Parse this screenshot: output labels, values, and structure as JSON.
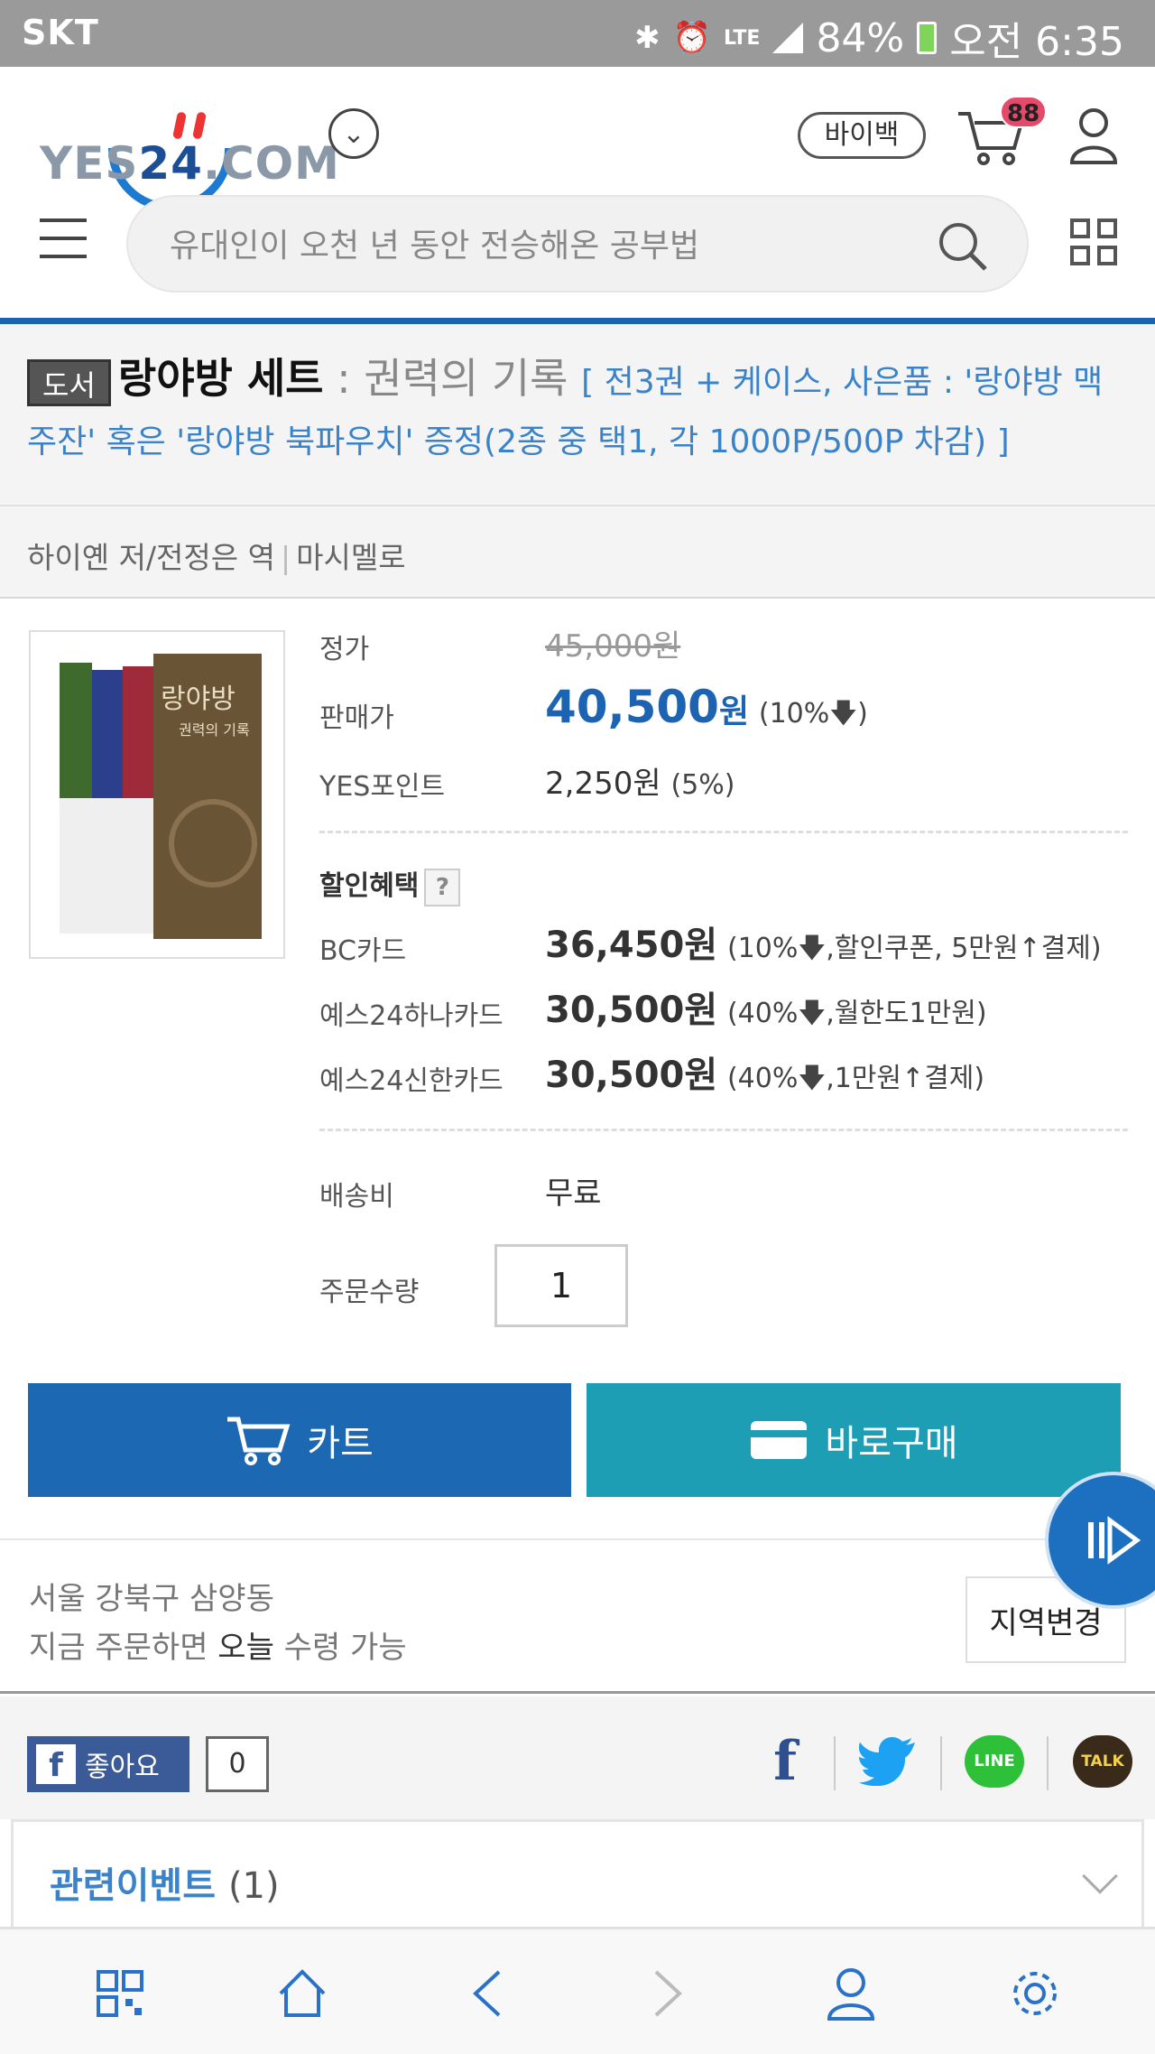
{
  "status_bar": {
    "carrier": "SKT",
    "network": "LTE",
    "battery": "84%",
    "time": "오전 6:35",
    "icons": [
      "bluetooth-icon",
      "alarm-icon",
      "lte-icon",
      "signal-icon",
      "battery-icon"
    ]
  },
  "header": {
    "logo_text_left": "YES",
    "logo_text_24": "24",
    "logo_text_right": ".COM",
    "payback_label": "바이백",
    "cart_count": "88",
    "search_placeholder": "유대인이 오천 년 동안 전승해온 공부법"
  },
  "product": {
    "category_badge": "도서",
    "title": "랑야방 세트",
    "subtitle": " : 권력의 기록 ",
    "bracket_info": "[ 전3권 + 케이스, 사은품 : '랑야방 맥주잔' 혹은 '랑야방 북파우치' 증정(2종 중 택1, 각 1000P/500P 차감) ]",
    "author": "하이옌 저/전정은 역",
    "publisher": "마시멜로",
    "cover_titles": [
      "랑야방",
      "권력의 기록"
    ]
  },
  "pricing": {
    "list_price_label": "정가",
    "list_price": "45,000원",
    "sale_price_label": "판매가",
    "sale_price": "40,500",
    "sale_price_unit": "원",
    "sale_discount": "(10%🡇)",
    "points_label": "YES포인트",
    "points": "2,250원",
    "points_rate": "(5%)",
    "discount_benefit_label": "할인혜택",
    "help_label": "?",
    "cards": [
      {
        "name": "BC카드",
        "price": "36,450원",
        "note": "(10%🡇,할인쿠폰, 5만원↑결제)"
      },
      {
        "name": "예스24하나카드",
        "price": "30,500원",
        "note": "(40%🡇,월한도1만원)"
      },
      {
        "name": "예스24신한카드",
        "price": "30,500원",
        "note": "(40%🡇,1만원↑결제)"
      }
    ],
    "shipping_label": "배송비",
    "shipping_value": "무료",
    "quantity_label": "주문수량",
    "quantity_value": "1"
  },
  "actions": {
    "cart_label": "카트",
    "buy_now_label": "바로구매"
  },
  "delivery": {
    "address": "서울 강북구 삼양동",
    "availability_prefix": "지금 주문하면 ",
    "availability_highlight": "오늘",
    "availability_suffix": " 수령 가능",
    "change_region_label": "지역변경"
  },
  "social": {
    "like_label": "좋아요",
    "like_count": "0",
    "line_label": "LINE",
    "talk_label": "TALK",
    "share_targets": [
      "facebook-icon",
      "twitter-icon",
      "line-icon",
      "kakaotalk-icon"
    ]
  },
  "events": {
    "title": "관련이벤트",
    "count": "(1)"
  },
  "bottom_nav": [
    "qr-code-icon",
    "home-icon",
    "back-icon",
    "forward-icon",
    "account-icon",
    "settings-icon"
  ],
  "colors": {
    "brand_blue": "#1c63b2",
    "buy_teal": "#1d9eb5",
    "link_blue": "#3b83c9",
    "badge_pink": "#e64a6a"
  }
}
